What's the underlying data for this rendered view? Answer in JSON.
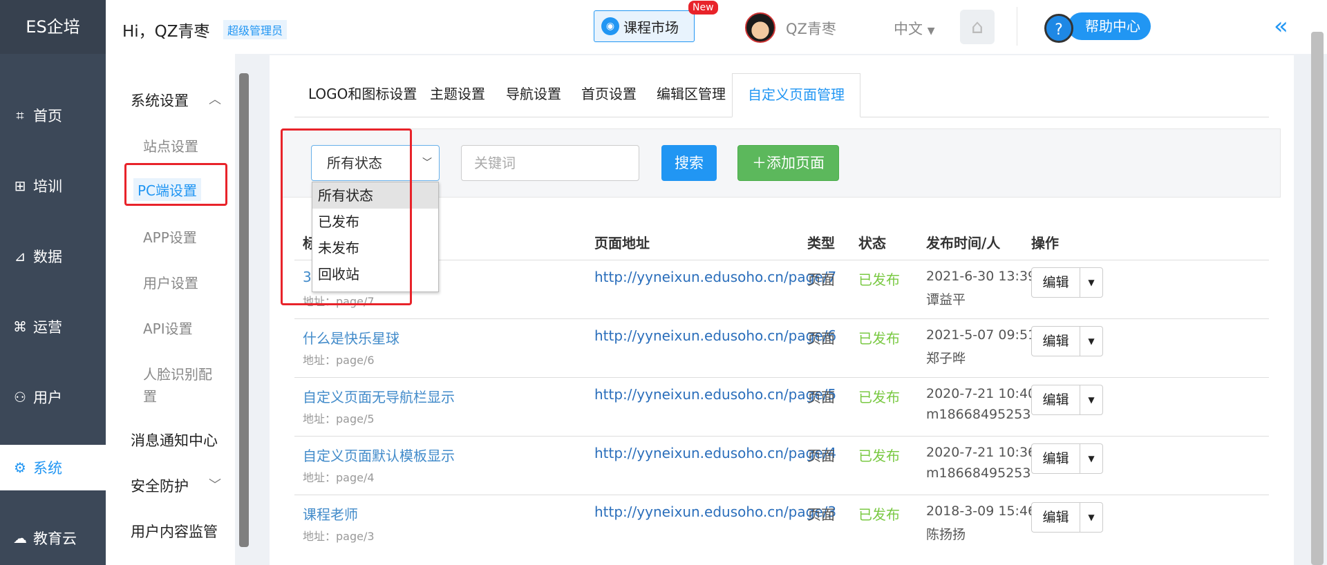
{
  "brand": "ES企培",
  "nav": [
    {
      "label": "首页",
      "icon": "chart-icon"
    },
    {
      "label": "培训",
      "icon": "training-icon"
    },
    {
      "label": "数据",
      "icon": "data-icon"
    },
    {
      "label": "运营",
      "icon": "operation-icon"
    },
    {
      "label": "用户",
      "icon": "user-icon"
    },
    {
      "label": "系统",
      "icon": "gear-icon",
      "active": true
    },
    {
      "label": "教育云",
      "icon": "cloud-icon"
    }
  ],
  "submenu": {
    "system_settings": "系统设置",
    "items": [
      "站点设置",
      "PC端设置",
      "APP设置",
      "用户设置",
      "API设置",
      "人脸识别配置"
    ],
    "notify": "消息通知中心",
    "security": "安全防护",
    "content_monitor": "用户内容监管"
  },
  "header": {
    "greeting": "Hi，QZ青枣",
    "role": "超级管理员",
    "market": "课程市场",
    "new_badge": "New",
    "username": "QZ青枣",
    "language": "中文",
    "help": "帮助中心"
  },
  "tabs": [
    "LOGO和图标设置",
    "主题设置",
    "导航设置",
    "首页设置",
    "编辑区管理",
    "自定义页面管理"
  ],
  "filter": {
    "status_selected": "所有状态",
    "status_options": [
      "所有状态",
      "已发布",
      "未发布",
      "回收站"
    ],
    "keyword_placeholder": "关键词",
    "search_label": "搜索",
    "add_label": "＋添加页面"
  },
  "table": {
    "headers": [
      "标",
      "页面地址",
      "类型",
      "状态",
      "发布时间/人",
      "操作"
    ],
    "rows": [
      {
        "title": "3",
        "addr": "地址：page/7",
        "url": "http://yyneixun.edusoho.cn/page/7",
        "type": "页面",
        "status": "已发布",
        "time": "2021-6-30 13:39",
        "who": "谭益平",
        "edit": "编辑"
      },
      {
        "title": "什么是快乐星球",
        "addr": "地址：page/6",
        "url": "http://yyneixun.edusoho.cn/page/6",
        "type": "页面",
        "status": "已发布",
        "time": "2021-5-07 09:51",
        "who": "郑子晔",
        "edit": "编辑"
      },
      {
        "title": "自定义页面无导航栏显示",
        "addr": "地址：page/5",
        "url": "http://yyneixun.edusoho.cn/page/5",
        "type": "页面",
        "status": "已发布",
        "time": "2020-7-21 10:40",
        "who": "m18668495253",
        "edit": "编辑"
      },
      {
        "title": "自定义页面默认模板显示",
        "addr": "地址：page/4",
        "url": "http://yyneixun.edusoho.cn/page/4",
        "type": "页面",
        "status": "已发布",
        "time": "2020-7-21 10:36",
        "who": "m18668495253",
        "edit": "编辑"
      },
      {
        "title": "课程老师",
        "addr": "地址：page/3",
        "url": "http://yyneixun.edusoho.cn/page/3",
        "type": "页面",
        "status": "已发布",
        "time": "2018-3-09 15:46",
        "who": "陈扬扬",
        "edit": "编辑"
      }
    ]
  },
  "colors": {
    "sidebar": "#3c4858",
    "accent": "#2196f3",
    "success": "#5cb85c",
    "published": "#7ac943",
    "highlight": "#e8232a"
  }
}
